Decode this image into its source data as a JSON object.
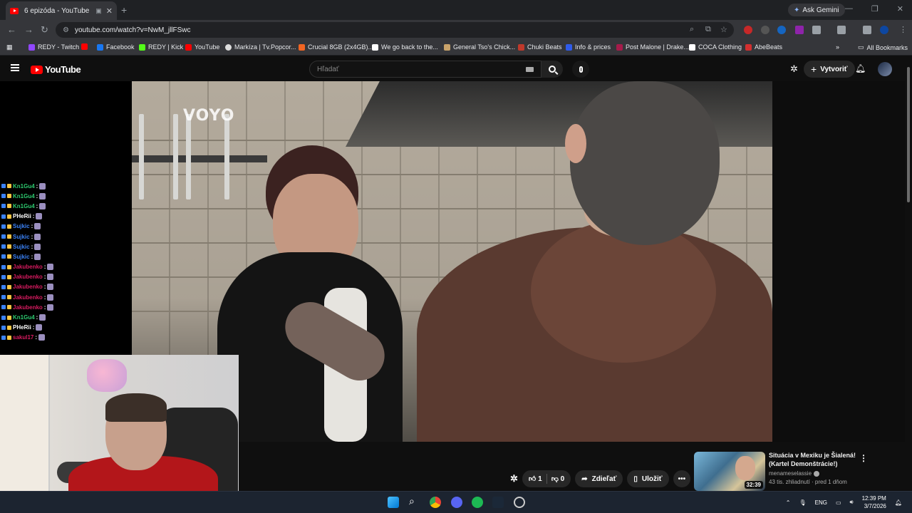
{
  "browser": {
    "tab_title": "6 epizóda - YouTube",
    "tab_close": "✕",
    "new_tab": "+",
    "ask_gemini": "Ask Gemini",
    "url": "youtube.com/watch?v=NwM_jllFSwc",
    "all_bookmarks": "All Bookmarks",
    "bookmarks_more": "»",
    "window_controls": [
      "—",
      "❐",
      "✕"
    ]
  },
  "bookmarks": [
    {
      "label": "REDY - Twitch",
      "color": "#9147ff"
    },
    {
      "label": "",
      "color": "#ff0000"
    },
    {
      "label": "Facebook",
      "color": "#1877f2"
    },
    {
      "label": "REDY | Kick",
      "color": "#53fc18"
    },
    {
      "label": "YouTube",
      "color": "#ff0000"
    },
    {
      "label": "Markíza | Tv.Popcor...",
      "color": "#dddddd"
    },
    {
      "label": "Crucial 8GB (2x4GB)...",
      "color": "#f26522"
    },
    {
      "label": "We go back to the...",
      "color": "#ffffff"
    },
    {
      "label": "General Tso's Chick...",
      "color": "#c9a36a"
    },
    {
      "label": "Chuki Beats",
      "color": "#c0392b"
    },
    {
      "label": "Info & prices",
      "color": "#2f5bea"
    },
    {
      "label": "Post Malone | Drake...",
      "color": "#a61b4a"
    },
    {
      "label": "COCA Clothing",
      "color": "#ffffff"
    },
    {
      "label": "AbeBeats",
      "color": "#d32f2f"
    }
  ],
  "youtube": {
    "logo_text": "YouTube",
    "search_placeholder": "Hľadať",
    "create_label": "Vytvoriť",
    "video_watermark": "VOYO"
  },
  "chat": [
    {
      "user": "Kn1Gu4",
      "color": "#2ecc71"
    },
    {
      "user": "Kn1Gu4",
      "color": "#2ecc71"
    },
    {
      "user": "Kn1Gu4",
      "color": "#2ecc71"
    },
    {
      "user": "PHeRii",
      "color": "#ffffff"
    },
    {
      "user": "Sujkic",
      "color": "#3b82f6"
    },
    {
      "user": "Sujkic",
      "color": "#3b82f6"
    },
    {
      "user": "Sujkic",
      "color": "#3b82f6"
    },
    {
      "user": "Sujkic",
      "color": "#3b82f6"
    },
    {
      "user": "Jakubenko",
      "color": "#d81b60"
    },
    {
      "user": "Jakubenko",
      "color": "#d81b60"
    },
    {
      "user": "Jakubenko",
      "color": "#d81b60"
    },
    {
      "user": "Jakubenko",
      "color": "#d81b60"
    },
    {
      "user": "Jakubenko",
      "color": "#d81b60"
    },
    {
      "user": "Kn1Gu4",
      "color": "#2ecc71"
    },
    {
      "user": "PHeRii",
      "color": "#ffffff"
    },
    {
      "user": "sakul17",
      "color": "#d81b60"
    }
  ],
  "actions": {
    "like_count": "1",
    "dislike_count": "0",
    "share_label": "Zdieľať",
    "save_label": "Uložiť",
    "more": "•••"
  },
  "recommended": {
    "title": "Situácia v Mexiku je Šialená! (Kartel Demonštrácie!)",
    "channel": "menameselassie",
    "meta": "43 tis. zhliadnutí · pred 1 dňom",
    "duration": "32:39",
    "more": "⋮"
  },
  "taskbar": {
    "language": "ENG",
    "time": "12:39 PM",
    "date": "3/7/2026"
  }
}
